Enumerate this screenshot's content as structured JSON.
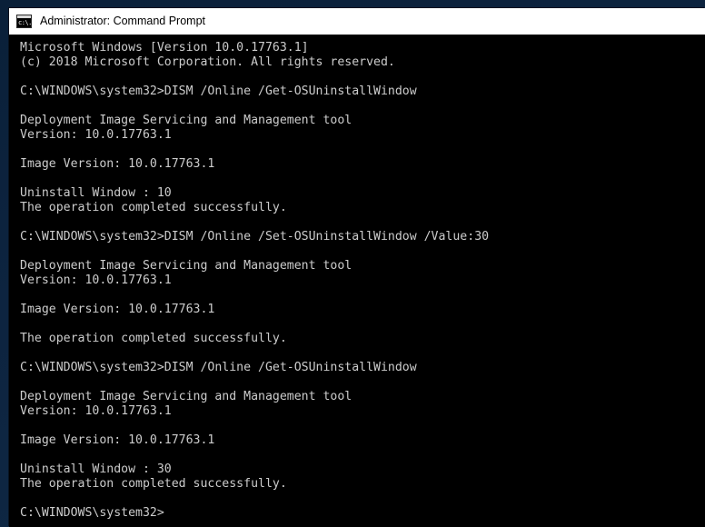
{
  "window": {
    "title": "Administrator: Command Prompt",
    "icon": "command-prompt-icon",
    "icon_glyph": "c:\\.",
    "titlebar_bg": "#ffffff",
    "titlebar_fg": "#000000"
  },
  "console": {
    "background": "#000000",
    "foreground": "#cccccc",
    "lines": [
      "Microsoft Windows [Version 10.0.17763.1]",
      "(c) 2018 Microsoft Corporation. All rights reserved.",
      "",
      "C:\\WINDOWS\\system32>DISM /Online /Get-OSUninstallWindow",
      "",
      "Deployment Image Servicing and Management tool",
      "Version: 10.0.17763.1",
      "",
      "Image Version: 10.0.17763.1",
      "",
      "Uninstall Window : 10",
      "The operation completed successfully.",
      "",
      "C:\\WINDOWS\\system32>DISM /Online /Set-OSUninstallWindow /Value:30",
      "",
      "Deployment Image Servicing and Management tool",
      "Version: 10.0.17763.1",
      "",
      "Image Version: 10.0.17763.1",
      "",
      "The operation completed successfully.",
      "",
      "C:\\WINDOWS\\system32>DISM /Online /Get-OSUninstallWindow",
      "",
      "Deployment Image Servicing and Management tool",
      "Version: 10.0.17763.1",
      "",
      "Image Version: 10.0.17763.1",
      "",
      "Uninstall Window : 30",
      "The operation completed successfully.",
      "",
      "C:\\WINDOWS\\system32>"
    ]
  },
  "desktop": {
    "background_color": "#0d2440"
  }
}
